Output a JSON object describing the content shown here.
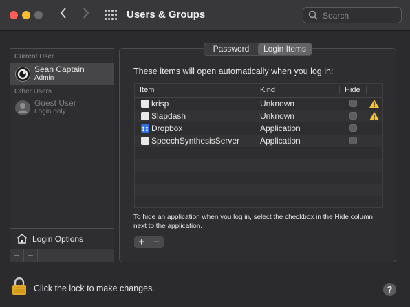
{
  "window": {
    "title": "Users & Groups"
  },
  "colors": {
    "close": "#ff5f57",
    "minimize": "#febc2e",
    "zoom": "#6a6a6c",
    "warning": "#f5c33b"
  },
  "search": {
    "placeholder": "Search"
  },
  "sidebar": {
    "current_user_header": "Current User",
    "current_user": {
      "name": "Sean Captain",
      "role": "Admin"
    },
    "other_users_header": "Other Users",
    "other_users": [
      {
        "name": "Guest User",
        "role": "Login only"
      }
    ],
    "login_options_label": "Login Options",
    "add_button": "+",
    "remove_button": "−"
  },
  "tabs": [
    {
      "label": "Password"
    },
    {
      "label": "Login Items",
      "active": true
    }
  ],
  "intro_text": "These items will open automatically when you log in:",
  "table": {
    "columns": {
      "item": "Item",
      "kind": "Kind",
      "hide": "Hide"
    },
    "rows": [
      {
        "name": "krisp",
        "kind": "Unknown",
        "icon": "blank-app-icon",
        "warning": true
      },
      {
        "name": "Slapdash",
        "kind": "Unknown",
        "icon": "blank-app-icon",
        "warning": true
      },
      {
        "name": "Dropbox",
        "kind": "Application",
        "icon": "dropbox-icon",
        "warning": false
      },
      {
        "name": "SpeechSynthesisServer",
        "kind": "Application",
        "icon": "blank-app-icon",
        "warning": false
      }
    ]
  },
  "help_text": "To hide an application when you log in, select the checkbox in the Hide column next to the application.",
  "add_button": "+",
  "remove_button": "−",
  "lock_text": "Click the lock to make changes.",
  "help_button": "?"
}
